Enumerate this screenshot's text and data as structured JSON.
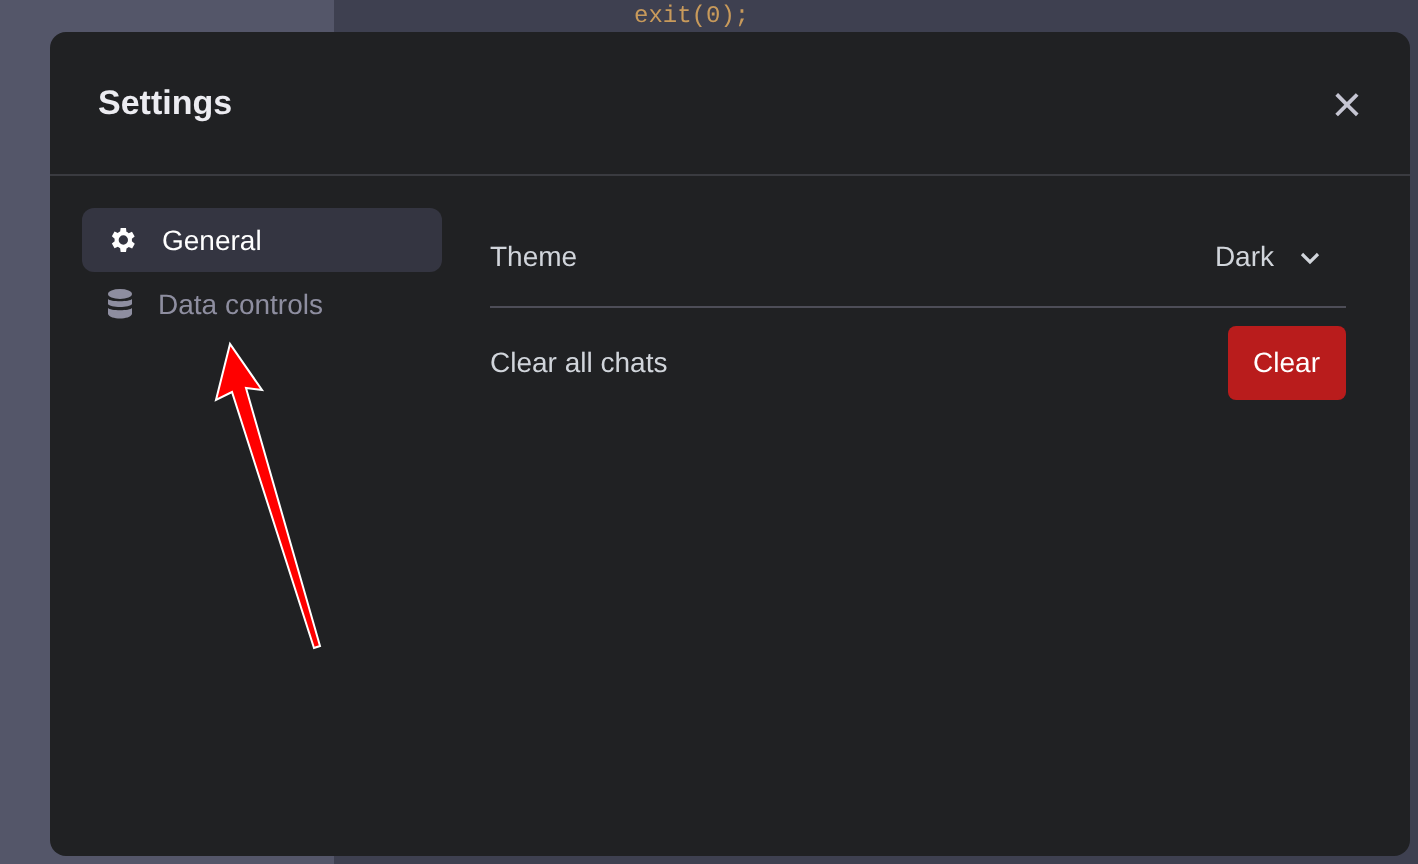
{
  "background": {
    "code_line": "exit(0);"
  },
  "dialog": {
    "title": "Settings",
    "close": "×",
    "sidebar": {
      "items": [
        {
          "kind": "gear",
          "label": "General",
          "selected": true
        },
        {
          "kind": "database",
          "label": "Data controls",
          "selected": false
        }
      ]
    },
    "rows": [
      {
        "kind": "select",
        "label": "Theme",
        "value": "Dark"
      },
      {
        "kind": "button",
        "label": "Clear all chats",
        "button": "Clear"
      }
    ]
  }
}
